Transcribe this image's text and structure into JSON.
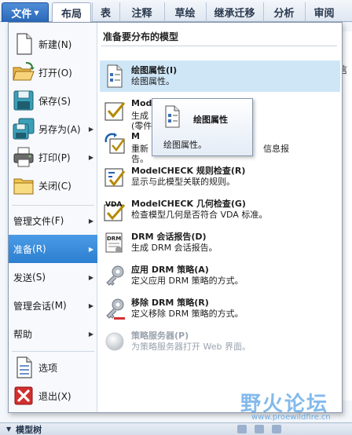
{
  "ribbon": {
    "file_tab": "文件",
    "tabs": [
      "布局",
      "表",
      "注释",
      "草绘",
      "继承迁移",
      "分析",
      "审阅"
    ]
  },
  "file_menu": {
    "left_icon_items": [
      {
        "label": "新建",
        "key": "(N)",
        "icon": "new-document-icon",
        "has_arrow": false
      },
      {
        "label": "打开",
        "key": "(O)",
        "icon": "open-folder-icon",
        "has_arrow": false
      },
      {
        "label": "保存",
        "key": "(S)",
        "icon": "save-disk-icon",
        "has_arrow": false
      },
      {
        "label": "另存为",
        "key": "(A)",
        "icon": "save-as-icon",
        "has_arrow": true
      },
      {
        "label": "打印",
        "key": "(P)",
        "icon": "printer-icon",
        "has_arrow": true
      },
      {
        "label": "关闭",
        "key": "(C)",
        "icon": "close-folder-icon",
        "has_arrow": false
      }
    ],
    "left_text_items": [
      {
        "label": "管理文件",
        "key": "(F)",
        "has_arrow": true
      },
      {
        "label": "准备",
        "key": "(R)",
        "has_arrow": true,
        "selected": true
      },
      {
        "label": "发送",
        "key": "(S)",
        "has_arrow": true
      },
      {
        "label": "管理会话",
        "key": "(M)",
        "has_arrow": true
      },
      {
        "label": "帮助",
        "key": "",
        "has_arrow": true
      }
    ],
    "left_bottom_items": [
      {
        "label": "选项",
        "key": "",
        "icon": "options-icon"
      },
      {
        "label": "退出",
        "key": "(X)",
        "icon": "exit-icon"
      }
    ]
  },
  "submenu": {
    "header": "准备要分布的模型",
    "items": [
      {
        "title": "绘图属性(I)",
        "desc": "绘图属性。",
        "desc2": "",
        "icon": "drawing-properties-icon",
        "hover": true
      },
      {
        "title": "ModelCHECK",
        "desc": "生成",
        "desc2": "(零件",
        "icon": "modelcheck-icon"
      },
      {
        "title": "M",
        "desc": "重新",
        "desc2": "告。",
        "extra": "信息报",
        "icon": "regenerate-icon"
      },
      {
        "title": "ModelCHECK 规则检查(R)",
        "desc": "显示与此模型关联的规则。",
        "desc2": "",
        "icon": "rule-check-icon"
      },
      {
        "title": "ModelCHECK 几何检查(G)",
        "desc": "检查模型几何是否符合 VDA 标准。",
        "desc2": "",
        "icon": "vda-icon"
      },
      {
        "title": "DRM 会话报告(D)",
        "desc": "生成 DRM 会话报告。",
        "desc2": "",
        "icon": "drm-report-icon"
      },
      {
        "title": "应用 DRM 策略(A)",
        "desc": "定义应用 DRM 策略的方式。",
        "desc2": "",
        "icon": "apply-key-icon"
      },
      {
        "title": "移除 DRM 策略(R)",
        "desc": "定义移除 DRM 策略的方式。",
        "desc2": "",
        "icon": "remove-key-icon"
      },
      {
        "title": "策略服务器(P)",
        "desc": "为策略服务器打开 Web 界面。",
        "desc2": "",
        "icon": "policy-server-icon",
        "disabled": true
      }
    ]
  },
  "tooltip": {
    "title": "绘图属性",
    "desc": "绘图属性。"
  },
  "background": {
    "right_char": "信",
    "bottom_bar": "模型树"
  },
  "watermark": {
    "text": "野火论坛",
    "url": "www.proewildfire.cn"
  },
  "colors": {
    "accent": "#2d7fd0",
    "hover": "#cfe6f7",
    "file_tab": "#2a67b8"
  }
}
